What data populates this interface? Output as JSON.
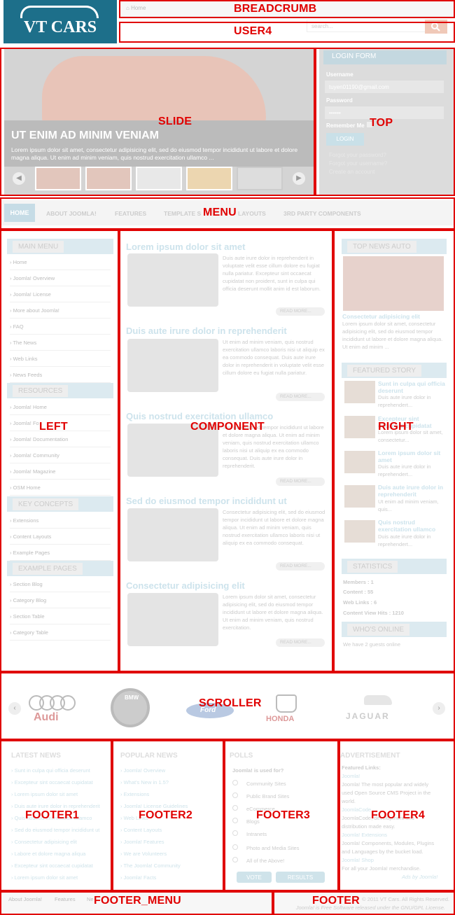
{
  "header": {
    "logo_text": "VT CARS",
    "breadcrumb_home": "Home",
    "search_placeholder": "search..."
  },
  "slide": {
    "title": "UT ENIM AD MINIM VENIAM",
    "description": "Lorem ipsum dolor sit amet, consectetur adipisicing elit, sed do eiusmod tempor incididunt ut labore et dolore magna aliqua. Ut enim ad minim veniam, quis nostrud exercitation ullamco ..."
  },
  "login": {
    "heading": "LOGIN FORM",
    "username_label": "Username",
    "username_value": "tuyen01190@gmail.com",
    "password_label": "Password",
    "password_value": "••••••",
    "remember_label": "Remember Me",
    "button": "LOGIN",
    "links": [
      "Forgot your password?",
      "Forgot your username?",
      "Create an account"
    ]
  },
  "menu": {
    "items": [
      "HOME",
      "ABOUT JOOMLA!",
      "FEATURES",
      "TEMPLATE S",
      "LAYOUTS",
      "3RD PARTY COMPONENTS"
    ]
  },
  "left": {
    "main_menu": "MAIN MENU",
    "main_items": [
      "Home",
      "Joomla! Overview",
      "Joomla! License",
      "More about Joomla!",
      "FAQ",
      "The News",
      "Web Links",
      "News Feeds"
    ],
    "resources": "RESOURCES",
    "resource_items": [
      "Joomla! Home",
      "Joomla! Fo",
      "Joomla! Documentation",
      "Joomla! Community",
      "Joomla! Magazine",
      "OSM Home"
    ],
    "key_concepts": "KEY CONCEPTS",
    "concept_items": [
      "Extensions",
      "Content Layouts",
      "Example Pages"
    ],
    "example_pages": "EXAMPLE PAGES",
    "example_items": [
      "Section Blog",
      "Category Blog",
      "Section Table",
      "Category Table"
    ]
  },
  "component": {
    "articles": [
      {
        "title": "Lorem ipsum dolor sit amet",
        "text": "Duis aute irure dolor in reprehenderit in voluptate velit esse cillum dolore eu fugiat nulla pariatur. Excepteur sint occaecat cupidatat non proident, sunt in culpa qui officia deserunt mollit anim id est laborum.",
        "more": "READ MORE..."
      },
      {
        "title": "Duis aute irure dolor in reprehenderit",
        "text": "Ut enim ad minim veniam, quis nostrud exercitation ullamco laboris nisi ut aliquip ex ea commodo consequat. Duis aute irure dolor in reprehenderit in voluptate velit esse cillum dolore eu fugiat nulla pariatur.",
        "more": "READ MORE..."
      },
      {
        "title": "Quis nostrud exercitation ullamco",
        "text": "Sed do eiusmod tempor incididunt ut labore et dolore magna aliqua. Ut enim ad minim veniam, quis nostrud exercitation ullamco laboris nisi ut aliquip ex ea commodo consequat. Duis aute irure dolor in reprehenderit.",
        "more": "READ MORE..."
      },
      {
        "title": "Sed do eiusmod tempor incididunt ut",
        "text": "Consectetur adipisicing elit, sed do eiusmod tempor incididunt ut labore et dolore magna aliqua. Ut enim ad minim veniam, quis nostrud exercitation ullamco laboris nisi ut aliquip ex ea commodo consequat.",
        "more": "READ MORE..."
      },
      {
        "title": "Consectetur adipisicing elit",
        "text": "Lorem ipsum dolor sit amet, consectetur adipisicing elit, sed do eiusmod tempor incididunt ut labore et dolore magna aliqua. Ut enim ad minim veniam, quis nostrud exercitation.",
        "more": "READ MORE..."
      }
    ]
  },
  "right": {
    "top_news": "TOP NEWS AUTO",
    "top_news_title": "Consectetur adipisicing elit",
    "top_news_text": "Lorem ipsum dolor sit amet, consectetur adipisicing elit, sed do eiusmod tempor incididunt ut labore et dolore magna aliqua. Ut enim ad minim ...",
    "featured": "FEATURED STORY",
    "featured_items": [
      {
        "title": "Sunt in culpa qui officia deserunt",
        "text": "Duis aute irure dolor in reprehendert..."
      },
      {
        "title": "Excepteur sint occaecat cupidatat",
        "text": "Lorem ipsum dolor sit amet, consectetur..."
      },
      {
        "title": "Lorem ipsum dolor sit amet",
        "text": "Duis aute irure dolor in reprehendert..."
      },
      {
        "title": "Duis aute irure dolor in reprehenderit",
        "text": "Ut enim ad minim veniam, quis..."
      },
      {
        "title": "Quis nostrud exercitation ullamco",
        "text": "Duis aute irure dolor in reprehendert..."
      }
    ],
    "statistics": "STATISTICS",
    "stats": [
      "Members : 1",
      "Content : 55",
      "Web Links : 6",
      "Content View Hits : 1210"
    ],
    "whos_online": "WHO'S ONLINE",
    "online_text": "We have 2 guests online"
  },
  "scroller": {
    "brands": [
      "Audi",
      "BMW",
      "Ford",
      "HONDA",
      "JAGUAR"
    ]
  },
  "footer1": {
    "heading": "LATEST NEWS",
    "items": [
      "Sunt in culpa qui officia deserunt",
      "Excepteur sint occaecat cupidatat",
      "Lorem ipsum dolor sit amet",
      "Duis aute irure dolor in reprehenderit",
      "Quis nostrud exercitation ullamco",
      "Sed do eiusmod tempor incididunt ut",
      "Consectetur adipisicing elit",
      "Labore et dolore magna aliqua",
      "Excepteur sint occaecat cupidatat",
      "Lorem ipsum dolor sit amet"
    ]
  },
  "footer2": {
    "heading": "POPULAR NEWS",
    "items": [
      "Joomla! Overview",
      "What's New in 1.5?",
      "Extensions",
      "Joomla! License Guidelines",
      "Web Links",
      "Content Layouts",
      "Joomla! Features",
      "We are Volunteers",
      "The Joomla! Community",
      "Joomla! Facts"
    ]
  },
  "footer3": {
    "heading": "POLLS",
    "question": "Joomla! is used for?",
    "options": [
      "Community Sites",
      "Public Brand Sites",
      "eCommerce",
      "Blogs",
      "Intranets",
      "Photo and Media Sites",
      "All of the Above!"
    ],
    "vote": "VOTE",
    "results": "RESULTS"
  },
  "footer4": {
    "heading": "ADVERTISEMENT",
    "lines": [
      "Featured Links:",
      "Joomla!",
      "Joomla! The most popular and widely",
      "used Open Source CMS Project in the",
      "world.",
      "JoomlaCode",
      "JoomlaCode, development and",
      "distribution made easy.",
      "Joomla! Extensions",
      "Joomla! Components, Modules, Plugins",
      "and Languages by the bucket load.",
      "Joomla! Shop",
      "For all your Joomla! merchandise."
    ],
    "ads_by": "Ads by Joomla!"
  },
  "footer_menu": {
    "items": [
      "About Joomla!",
      "Features",
      "Ne"
    ]
  },
  "footer": {
    "line1": "© 2011 VT Cars. All Rights Reserved.",
    "line2": "Joomla! is Free Software released under the GNU/GPL License."
  },
  "region_labels": {
    "breadcrumb": "BREADCRUMB",
    "user4": "USER4",
    "slide": "SLIDE",
    "top": "TOP",
    "menu": "MENU",
    "left": "LEFT",
    "component": "COMPONENT",
    "right": "RIGHT",
    "scroller": "SCROLLER",
    "footer1": "FOOTER1",
    "footer2": "FOOTER2",
    "footer3": "FOOTER3",
    "footer4": "FOOTER4",
    "footer_menu": "FOOTER_MENU",
    "footer": "FOOTER"
  }
}
